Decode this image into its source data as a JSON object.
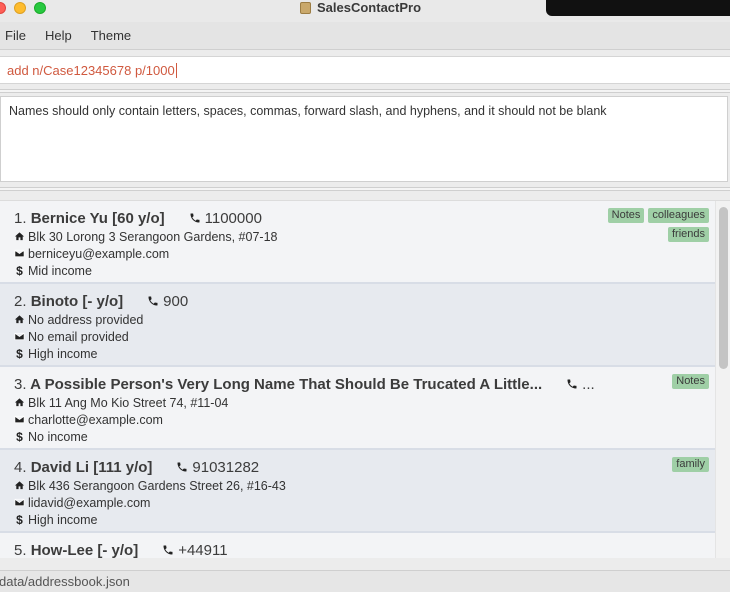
{
  "window": {
    "title": "SalesContactPro"
  },
  "menu": {
    "items": [
      "File",
      "Help",
      "Theme"
    ]
  },
  "command": {
    "value": "add n/Case12345678 p/1000"
  },
  "result": {
    "message": "Names should only contain letters, spaces, commas, forward slash, and hyphens, and it should not be blank"
  },
  "contacts": [
    {
      "index": "1.",
      "name": "Bernice Yu [60 y/o]",
      "phone": "1100000",
      "address": "Blk 30 Lorong 3 Serangoon Gardens, #07-18",
      "email": "berniceyu@example.com",
      "income": "Mid income",
      "tags": [
        "Notes",
        "colleagues",
        "friends"
      ]
    },
    {
      "index": "2.",
      "name": "Binoto [- y/o]",
      "phone": "900",
      "address": "No address provided",
      "email": "No email provided",
      "income": "High income",
      "tags": []
    },
    {
      "index": "3.",
      "name": "A Possible Person's Very Long Name That Should Be Trucated A Little...",
      "phone": "...",
      "address": "Blk 11 Ang Mo Kio Street 74, #11-04",
      "email": "charlotte@example.com",
      "income": "No income",
      "tags": [
        "Notes"
      ]
    },
    {
      "index": "4.",
      "name": "David Li [111 y/o]",
      "phone": "91031282",
      "address": "Blk 436 Serangoon Gardens Street 26, #16-43",
      "email": "lidavid@example.com",
      "income": "High income",
      "tags": [
        "family"
      ]
    },
    {
      "index": "5.",
      "name": "How-Lee [- y/o]",
      "phone": "+44911",
      "address": "",
      "email": "",
      "income": "",
      "tags": []
    }
  ],
  "icons": {
    "phone": "phone-icon",
    "address": "home-icon",
    "email": "envelope-icon",
    "income": "dollar-icon"
  },
  "colors": {
    "command_text": "#d0593f",
    "tag_background": "#9fcfa6",
    "card_odd": "#f3f4f6",
    "card_even": "#e7eaef"
  },
  "status": {
    "path": "data/addressbook.json"
  }
}
